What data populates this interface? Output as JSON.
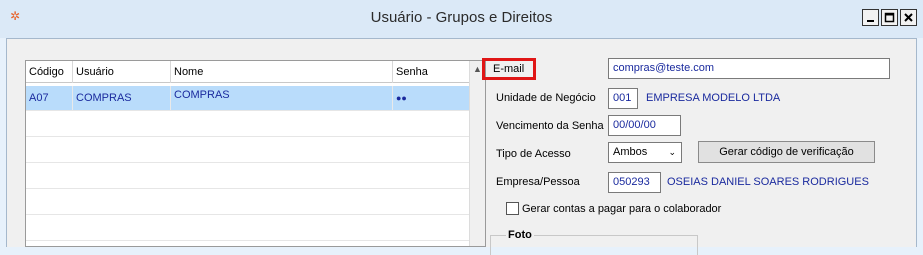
{
  "window": {
    "title": "Usuário - Grupos e Direitos",
    "icon": "app-icon",
    "controls": [
      "minimize-icon",
      "maximize-icon",
      "close-icon"
    ]
  },
  "grid": {
    "columns": [
      "Código",
      "Usuário",
      "Nome",
      "Senha"
    ],
    "rows": [
      {
        "codigo": "A07",
        "usuario": "COMPRAS",
        "nome": "COMPRAS",
        "senha": "●●",
        "selected": true
      }
    ]
  },
  "form": {
    "email_label": "E-mail",
    "email_value": "compras@teste.com",
    "unidade_label": "Unidade de Negócio",
    "unidade_code": "001",
    "unidade_name": "EMPRESA MODELO LTDA",
    "vencimento_label": "Vencimento da Senha",
    "vencimento_value": "00/00/00",
    "tipo_label": "Tipo de Acesso",
    "tipo_value": "Ambos",
    "gerar_button": "Gerar código de verificação",
    "empresa_label": "Empresa/Pessoa",
    "empresa_code": "050293",
    "empresa_name": "OSEIAS DANIEL SOARES RODRIGUES",
    "contas_checkbox_label": "Gerar contas a pagar para o colaborador",
    "foto_label": "Foto"
  },
  "colors": {
    "highlight_border": "#e01616",
    "selected_row": "#b9dcfb",
    "value_text": "#1a2a9e",
    "titlebar": "#dbe9f7"
  }
}
